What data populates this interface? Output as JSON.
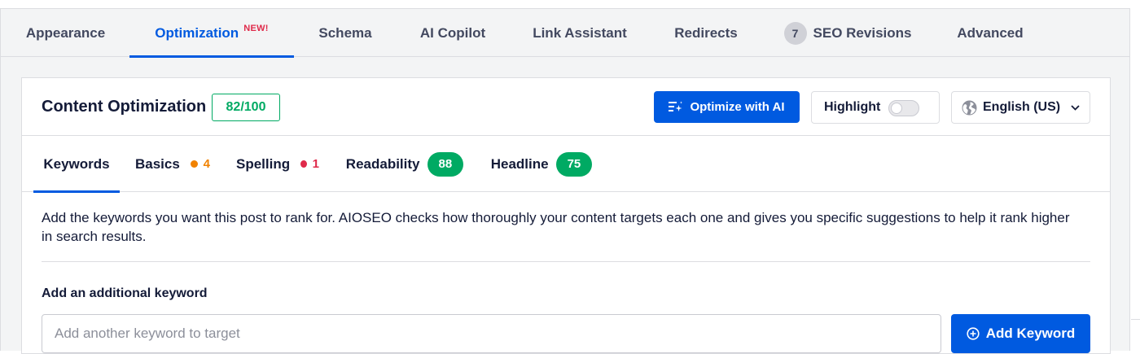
{
  "top_tabs": [
    {
      "label": "Appearance"
    },
    {
      "label": "Optimization",
      "badge": "NEW!"
    },
    {
      "label": "Schema"
    },
    {
      "label": "AI Copilot"
    },
    {
      "label": "Link Assistant"
    },
    {
      "label": "Redirects"
    },
    {
      "label": "SEO Revisions",
      "count": "7"
    },
    {
      "label": "Advanced"
    }
  ],
  "header": {
    "title": "Content Optimization",
    "score": "82/100",
    "optimize_label": "Optimize with AI",
    "highlight_label": "Highlight",
    "highlight_on": false,
    "language": "English (US)"
  },
  "sub_tabs": [
    {
      "label": "Keywords"
    },
    {
      "label": "Basics",
      "count": "4",
      "dot_color": "#f18200"
    },
    {
      "label": "Spelling",
      "count": "1",
      "dot_color": "#df2a4a"
    },
    {
      "label": "Readability",
      "score": "88"
    },
    {
      "label": "Headline",
      "score": "75"
    }
  ],
  "keywords": {
    "description": "Add the keywords you want this post to rank for. AIOSEO checks how thoroughly your content targets each one and gives you specific suggestions to help it rank higher in search results.",
    "field_label": "Add an additional keyword",
    "input_placeholder": "Add another keyword to target",
    "input_value": "",
    "add_label": "Add Keyword"
  },
  "colors": {
    "accent": "#005ae0",
    "success": "#00aa63",
    "warning": "#f18200",
    "error": "#df2a4a"
  },
  "icons": {
    "optimize": "ai-sparkle-list-icon",
    "language": "globe-icon",
    "dropdown": "chevron-down-icon",
    "add": "plus-circle-icon"
  }
}
